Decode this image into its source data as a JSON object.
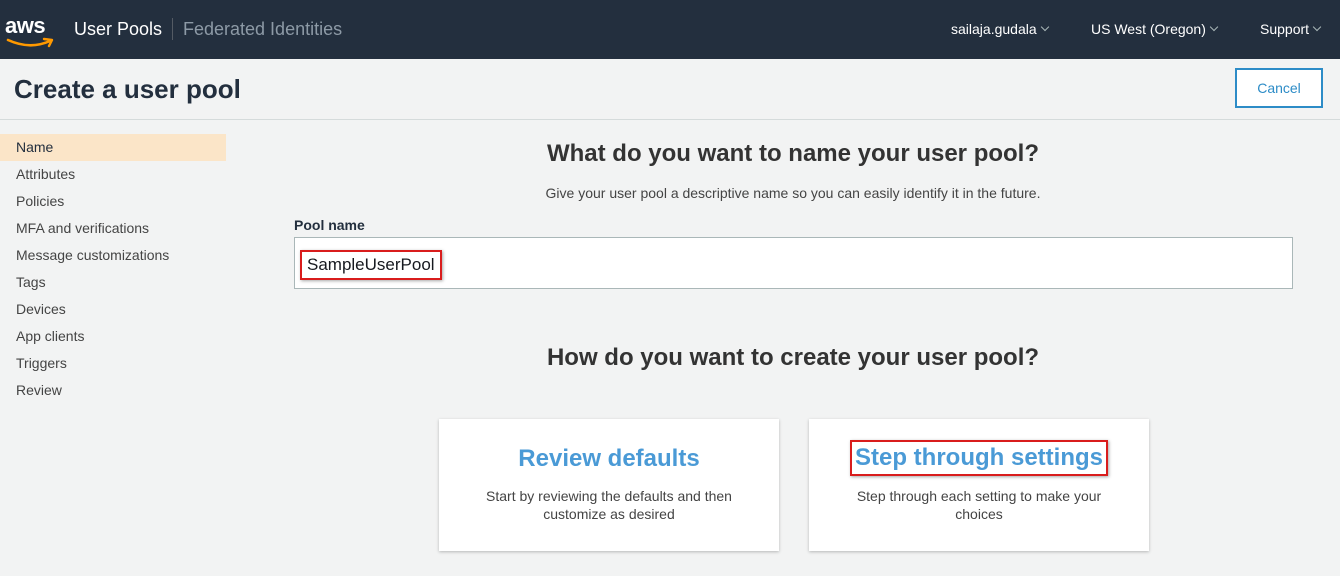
{
  "topbar": {
    "logo_text": "aws",
    "nav": [
      "User Pools",
      "Federated Identities"
    ],
    "user": "sailaja.gudala",
    "region": "US West (Oregon)",
    "support": "Support"
  },
  "header": {
    "title": "Create a user pool",
    "cancel_label": "Cancel"
  },
  "sidebar": {
    "items": [
      {
        "label": "Name",
        "active": true
      },
      {
        "label": "Attributes"
      },
      {
        "label": "Policies"
      },
      {
        "label": "MFA and verifications"
      },
      {
        "label": "Message customizations"
      },
      {
        "label": "Tags"
      },
      {
        "label": "Devices"
      },
      {
        "label": "App clients"
      },
      {
        "label": "Triggers"
      },
      {
        "label": "Review"
      }
    ]
  },
  "main": {
    "name_heading": "What do you want to name your user pool?",
    "name_subtext": "Give your user pool a descriptive name so you can easily identify it in the future.",
    "pool_name_label": "Pool name",
    "pool_name_value": "SampleUserPool",
    "create_heading": "How do you want to create your user pool?",
    "options": [
      {
        "title": "Review defaults",
        "description": "Start by reviewing the defaults and then customize as desired"
      },
      {
        "title": "Step through settings",
        "description": "Step through each setting to make your choices"
      }
    ]
  },
  "colors": {
    "topbar": "#232f3e",
    "accent_link": "#4a9ad6",
    "active_nav": "#fbe5c8",
    "highlight_box": "#d91c1c"
  }
}
